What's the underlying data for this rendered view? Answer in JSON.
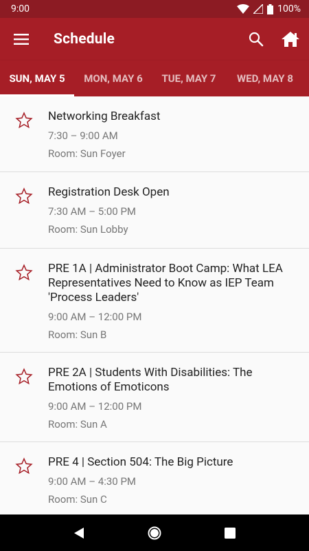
{
  "status_bar": {
    "time": "9:00",
    "battery": "100%"
  },
  "app_bar": {
    "title": "Schedule"
  },
  "tabs": [
    {
      "label": "SUN, MAY 5",
      "active": true
    },
    {
      "label": "MON, MAY 6",
      "active": false
    },
    {
      "label": "TUE, MAY 7",
      "active": false
    },
    {
      "label": "WED, MAY 8",
      "active": false
    }
  ],
  "sessions": [
    {
      "title": "Networking Breakfast",
      "time": "7:30 – 9:00 AM",
      "room": "Room:  Sun Foyer"
    },
    {
      "title": "Registration Desk Open",
      "time": "7:30 AM – 5:00 PM",
      "room": "Room:  Sun Lobby"
    },
    {
      "title": "PRE 1A | Administrator Boot Camp: What LEA Representatives Need to Know as IEP Team 'Process Leaders'",
      "time": "9:00 AM – 12:00 PM",
      "room": "Room:  Sun B"
    },
    {
      "title": "PRE 2A | Students With Disabilities: The Emotions of Emoticons",
      "time": "9:00 AM – 12:00 PM",
      "room": "Room:  Sun A"
    },
    {
      "title": "PRE 4 | Section 504: The Big Picture",
      "time": "9:00 AM – 4:30 PM",
      "room": "Room:  Sun C"
    }
  ],
  "colors": {
    "primary": "#a61e26",
    "status_bar": "#8c1b23",
    "star": "#a61e26"
  },
  "icons": {
    "menu": "menu-icon",
    "search": "search-icon",
    "home": "home-icon",
    "star": "star-outline-icon",
    "back": "back-icon",
    "home_nav": "home-circle-icon",
    "recents": "recents-icon"
  }
}
